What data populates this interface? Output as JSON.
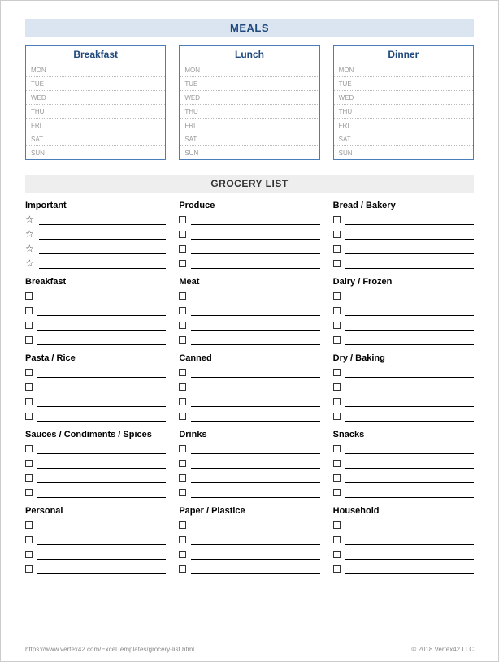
{
  "meals": {
    "header": "MEALS",
    "columns": [
      "Breakfast",
      "Lunch",
      "Dinner"
    ],
    "days": [
      "MON",
      "TUE",
      "WED",
      "THU",
      "FRI",
      "SAT",
      "SUN"
    ]
  },
  "grocery": {
    "header": "GROCERY LIST",
    "columns": [
      [
        {
          "name": "Important",
          "marker": "star",
          "lines": 4
        },
        {
          "name": "Breakfast",
          "marker": "box",
          "lines": 4
        },
        {
          "name": "Pasta / Rice",
          "marker": "box",
          "lines": 4
        },
        {
          "name": "Sauces / Condiments / Spices",
          "marker": "box",
          "lines": 4
        },
        {
          "name": "Personal",
          "marker": "box",
          "lines": 4
        }
      ],
      [
        {
          "name": "Produce",
          "marker": "box",
          "lines": 4
        },
        {
          "name": "Meat",
          "marker": "box",
          "lines": 4
        },
        {
          "name": "Canned",
          "marker": "box",
          "lines": 4
        },
        {
          "name": "Drinks",
          "marker": "box",
          "lines": 4
        },
        {
          "name": "Paper / Plastice",
          "marker": "box",
          "lines": 4
        }
      ],
      [
        {
          "name": "Bread / Bakery",
          "marker": "box",
          "lines": 4
        },
        {
          "name": "Dairy / Frozen",
          "marker": "box",
          "lines": 4
        },
        {
          "name": "Dry / Baking",
          "marker": "box",
          "lines": 4
        },
        {
          "name": "Snacks",
          "marker": "box",
          "lines": 4
        },
        {
          "name": "Household",
          "marker": "box",
          "lines": 4
        }
      ]
    ]
  },
  "footer": {
    "url": "https://www.vertex42.com/ExcelTemplates/grocery-list.html",
    "copyright": "© 2018 Vertex42 LLC"
  }
}
